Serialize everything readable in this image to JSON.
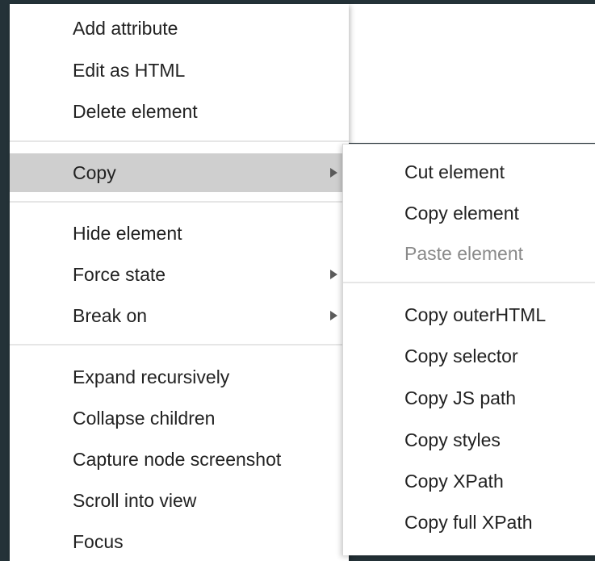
{
  "main_menu": {
    "items": [
      {
        "label": "Add attribute"
      },
      {
        "label": "Edit as HTML"
      },
      {
        "label": "Delete element"
      },
      {
        "label": "Copy",
        "submenu": true,
        "highlighted": true
      },
      {
        "label": "Hide element"
      },
      {
        "label": "Force state",
        "submenu": true
      },
      {
        "label": "Break on",
        "submenu": true
      },
      {
        "label": "Expand recursively"
      },
      {
        "label": "Collapse children"
      },
      {
        "label": "Capture node screenshot"
      },
      {
        "label": "Scroll into view"
      },
      {
        "label": "Focus"
      }
    ]
  },
  "copy_submenu": {
    "items": [
      {
        "label": "Cut element"
      },
      {
        "label": "Copy element"
      },
      {
        "label": "Paste element",
        "disabled": true
      },
      {
        "label": "Copy outerHTML"
      },
      {
        "label": "Copy selector"
      },
      {
        "label": "Copy JS path"
      },
      {
        "label": "Copy styles"
      },
      {
        "label": "Copy XPath"
      },
      {
        "label": "Copy full XPath"
      }
    ]
  },
  "colors": {
    "background": "#243238",
    "menu": "#ffffff",
    "highlight": "#cfcfcf",
    "text": "#222222",
    "disabled_text": "#8a8a8a"
  }
}
